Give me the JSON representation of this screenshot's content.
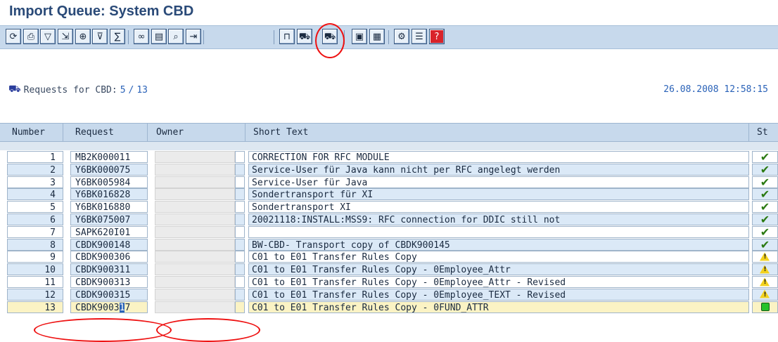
{
  "page": {
    "title": "Import Queue: System CBD"
  },
  "toolbar": {
    "buttons": [
      {
        "name": "refresh-icon",
        "glyph": "⟳"
      },
      {
        "name": "print-icon",
        "glyph": "⎙"
      },
      {
        "name": "filter-icon",
        "glyph": "▽"
      },
      {
        "name": "select-icon",
        "glyph": "⇲"
      },
      {
        "name": "zoom-icon",
        "glyph": "⊕"
      },
      {
        "name": "set-filter-icon",
        "glyph": "⊽"
      },
      {
        "name": "aggregate-icon",
        "glyph": "∑"
      },
      {
        "name": "glasses-icon",
        "glyph": "∞"
      },
      {
        "name": "document-icon",
        "glyph": "▤"
      },
      {
        "name": "find-icon",
        "glyph": "⌕"
      },
      {
        "name": "export-icon",
        "glyph": "⇥"
      },
      {
        "name": "lock-icon",
        "glyph": "⊓"
      },
      {
        "name": "truck-all-icon",
        "glyph": "⛟"
      },
      {
        "name": "truck-request-icon",
        "glyph": "⛟"
      },
      {
        "name": "monitor-icon",
        "glyph": "▣"
      },
      {
        "name": "log-icon",
        "glyph": "▦"
      },
      {
        "name": "settings-icon",
        "glyph": "⚙"
      },
      {
        "name": "list-icon",
        "glyph": "☰"
      },
      {
        "name": "help-icon",
        "glyph": "?"
      }
    ]
  },
  "info": {
    "label": "Requests for CBD:",
    "shown": "5",
    "separator": "/",
    "total": "13",
    "timestamp": "26.08.2008 12:58:15"
  },
  "table": {
    "headers": {
      "number": "Number",
      "request": "Request",
      "owner": "Owner",
      "short_text": "Short Text",
      "status": "St"
    },
    "rows": [
      {
        "number": "1",
        "request": "MB2K000011",
        "text": "CORRECTION FOR RFC MODULE",
        "status": "check"
      },
      {
        "number": "2",
        "request": "Y6BK000075",
        "text": "Service-User für Java kann nicht per RFC angelegt werden",
        "status": "check"
      },
      {
        "number": "3",
        "request": "Y6BK005984",
        "text": "Service-User für Java",
        "status": "check"
      },
      {
        "number": "4",
        "request": "Y6BK016828",
        "text": "Sondertransport für XI",
        "status": "check"
      },
      {
        "number": "5",
        "request": "Y6BK016880",
        "text": "Sondertransport XI",
        "status": "check"
      },
      {
        "number": "6",
        "request": "Y6BK075007",
        "text": "20021118:INSTALL:MSS9: RFC connection for DDIC still not",
        "status": "check"
      },
      {
        "number": "7",
        "request": "SAPK620I01",
        "text": "",
        "status": "check"
      },
      {
        "number": "8",
        "request": "CBDK900148",
        "text": "BW-CBD- Transport copy of CBDK900145",
        "status": "check"
      },
      {
        "number": "9",
        "request": "CBDK900306",
        "text": "C01 to E01 Transfer Rules Copy",
        "status": "warn"
      },
      {
        "number": "10",
        "request": "CBDK900311",
        "text": "C01 to E01 Transfer Rules Copy - 0Employee_Attr",
        "status": "warn"
      },
      {
        "number": "11",
        "request": "CBDK900313",
        "text": "C01 to E01 Transfer Rules Copy - 0Employee_Attr - Revised",
        "status": "warn"
      },
      {
        "number": "12",
        "request": "CBDK900315",
        "text": "C01 to E01 Transfer Rules Copy - 0Employee_TEXT - Revised",
        "status": "warn"
      },
      {
        "number": "13",
        "request_pre": "CBDK9003",
        "request_hl": "1",
        "request_post": "7",
        "text": "C01 to E01 Transfer Rules Copy - 0FUND_ATTR",
        "status": "ok",
        "selected": true
      }
    ]
  },
  "colors": {
    "accent": "#2a4a78",
    "toolbar_bg": "#c7d9ec",
    "row_even": "#dbe9f7",
    "selected_row": "#fbf3c4",
    "annotation_red": "#e11111"
  }
}
